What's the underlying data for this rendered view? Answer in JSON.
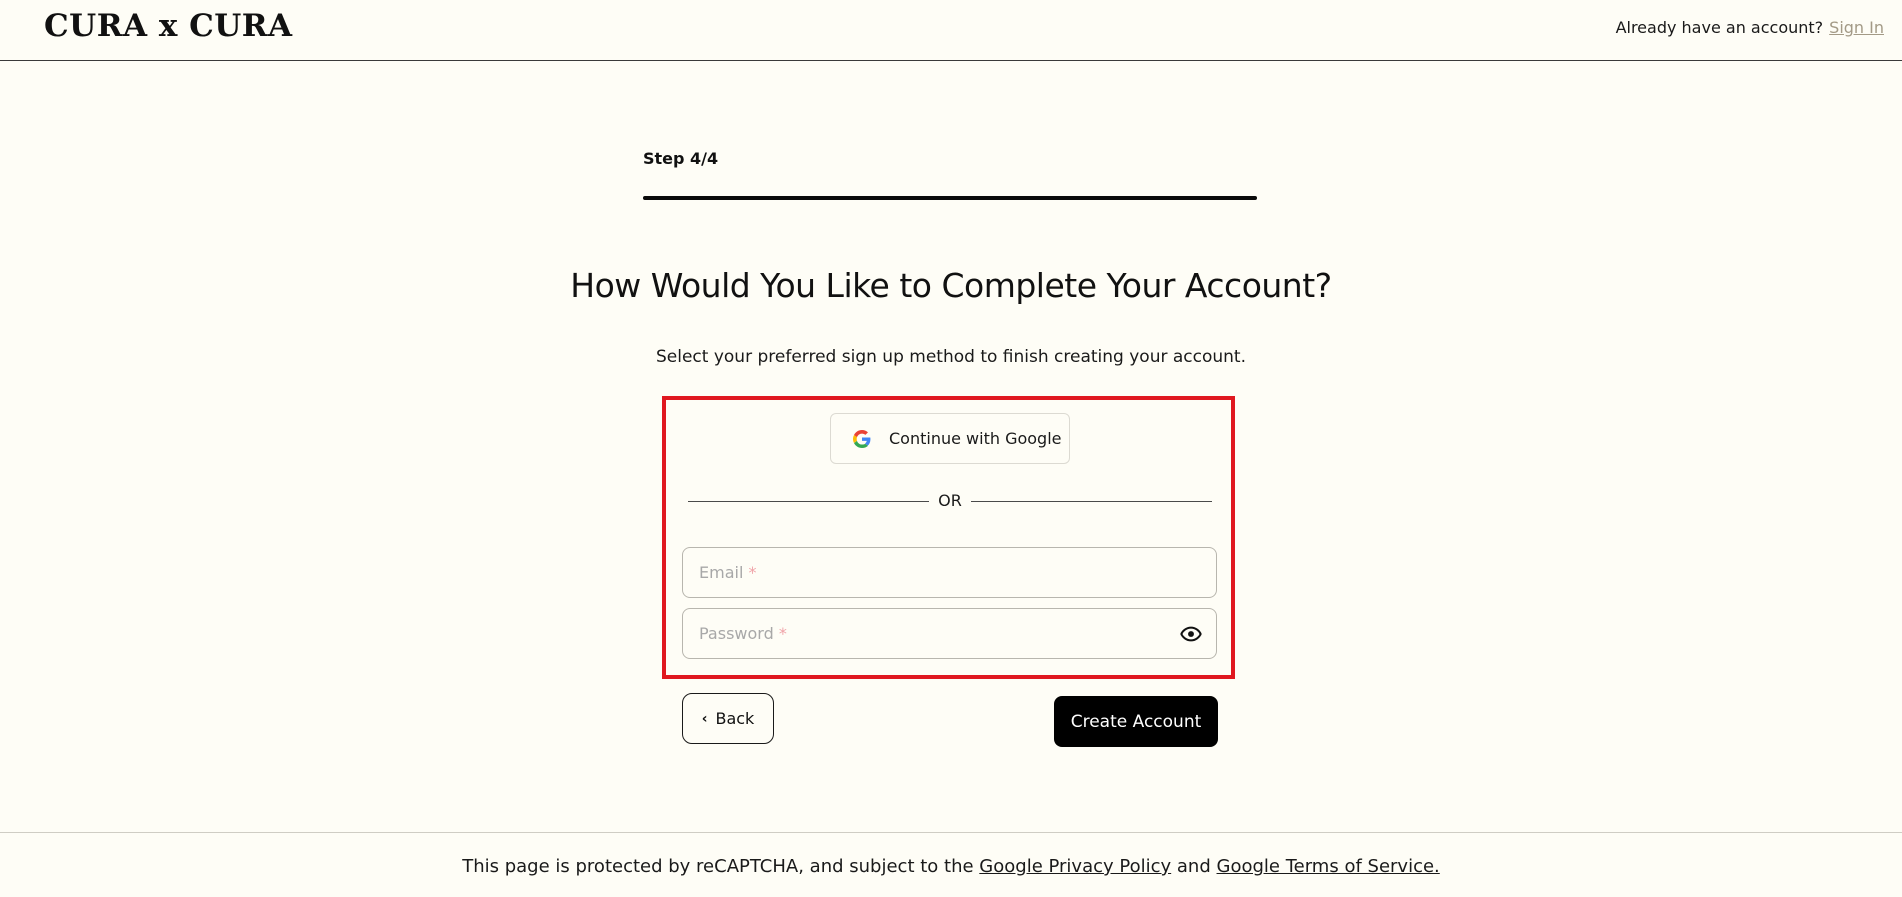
{
  "header": {
    "logo": "CURA x CURA",
    "account_prompt": "Already have an account?",
    "signin_label": "Sign In"
  },
  "step": {
    "label": "Step 4/4",
    "progress": 1.0
  },
  "main": {
    "title": "How Would You Like to Complete Your Account?",
    "subtitle": "Select your preferred sign up method to finish creating your account.",
    "google_label": "Continue with Google",
    "or_label": "OR",
    "email_placeholder": "Email",
    "password_placeholder": "Password",
    "required_mark": "*"
  },
  "actions": {
    "back_label": "Back",
    "create_label": "Create Account"
  },
  "footer": {
    "text_before": "This page is protected by reCAPTCHA, and subject to the",
    "privacy_link": "Google Privacy Policy",
    "and_text": "and",
    "terms_link": "Google Terms of Service."
  },
  "colors": {
    "background": "#fefdf6",
    "highlight_border": "#e0181f",
    "primary_button": "#000000",
    "signin_link": "#a39a86",
    "required_mark": "#f0a3a8"
  },
  "icons": {
    "google": "google-g-icon",
    "eye": "eye-icon",
    "back": "chevron-left-icon"
  }
}
